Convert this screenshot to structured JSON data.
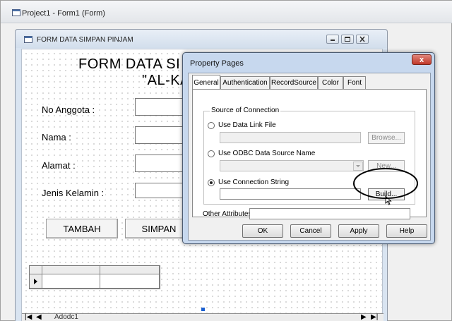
{
  "ide": {
    "title": "Project1 - Form1 (Form)"
  },
  "form": {
    "title": "FORM DATA SIMPAN PINJAM",
    "heading1": "FORM DATA SI",
    "heading2": "\"AL-KA",
    "fields": [
      {
        "label": "No Anggota :"
      },
      {
        "label": "Nama :"
      },
      {
        "label": "Alamat :"
      },
      {
        "label": "Jenis Kelamin :"
      }
    ],
    "buttons": {
      "tambah": "TAMBAH",
      "simpan": "SIMPAN"
    },
    "adodc": {
      "caption": "Adodc1",
      "first": "|◀",
      "prev": "◀",
      "next": "▶",
      "last": "▶|"
    }
  },
  "dialog": {
    "title": "Property Pages",
    "close": "x",
    "tabs": [
      "General",
      "Authentication",
      "RecordSource",
      "Color",
      "Font"
    ],
    "active_tab": "General",
    "group_label": "Source of Connection",
    "options": [
      {
        "label": "Use Data Link File",
        "button": "Browse...",
        "selected": false
      },
      {
        "label": "Use ODBC Data Source Name",
        "button": "New...",
        "selected": false
      },
      {
        "label": "Use Connection String",
        "button": "Build...",
        "selected": true
      }
    ],
    "other_attributes_label": "Other Attributes:",
    "other_attributes_value": "",
    "buttons": {
      "ok": "OK",
      "cancel": "Cancel",
      "apply": "Apply",
      "help": "Help"
    }
  }
}
